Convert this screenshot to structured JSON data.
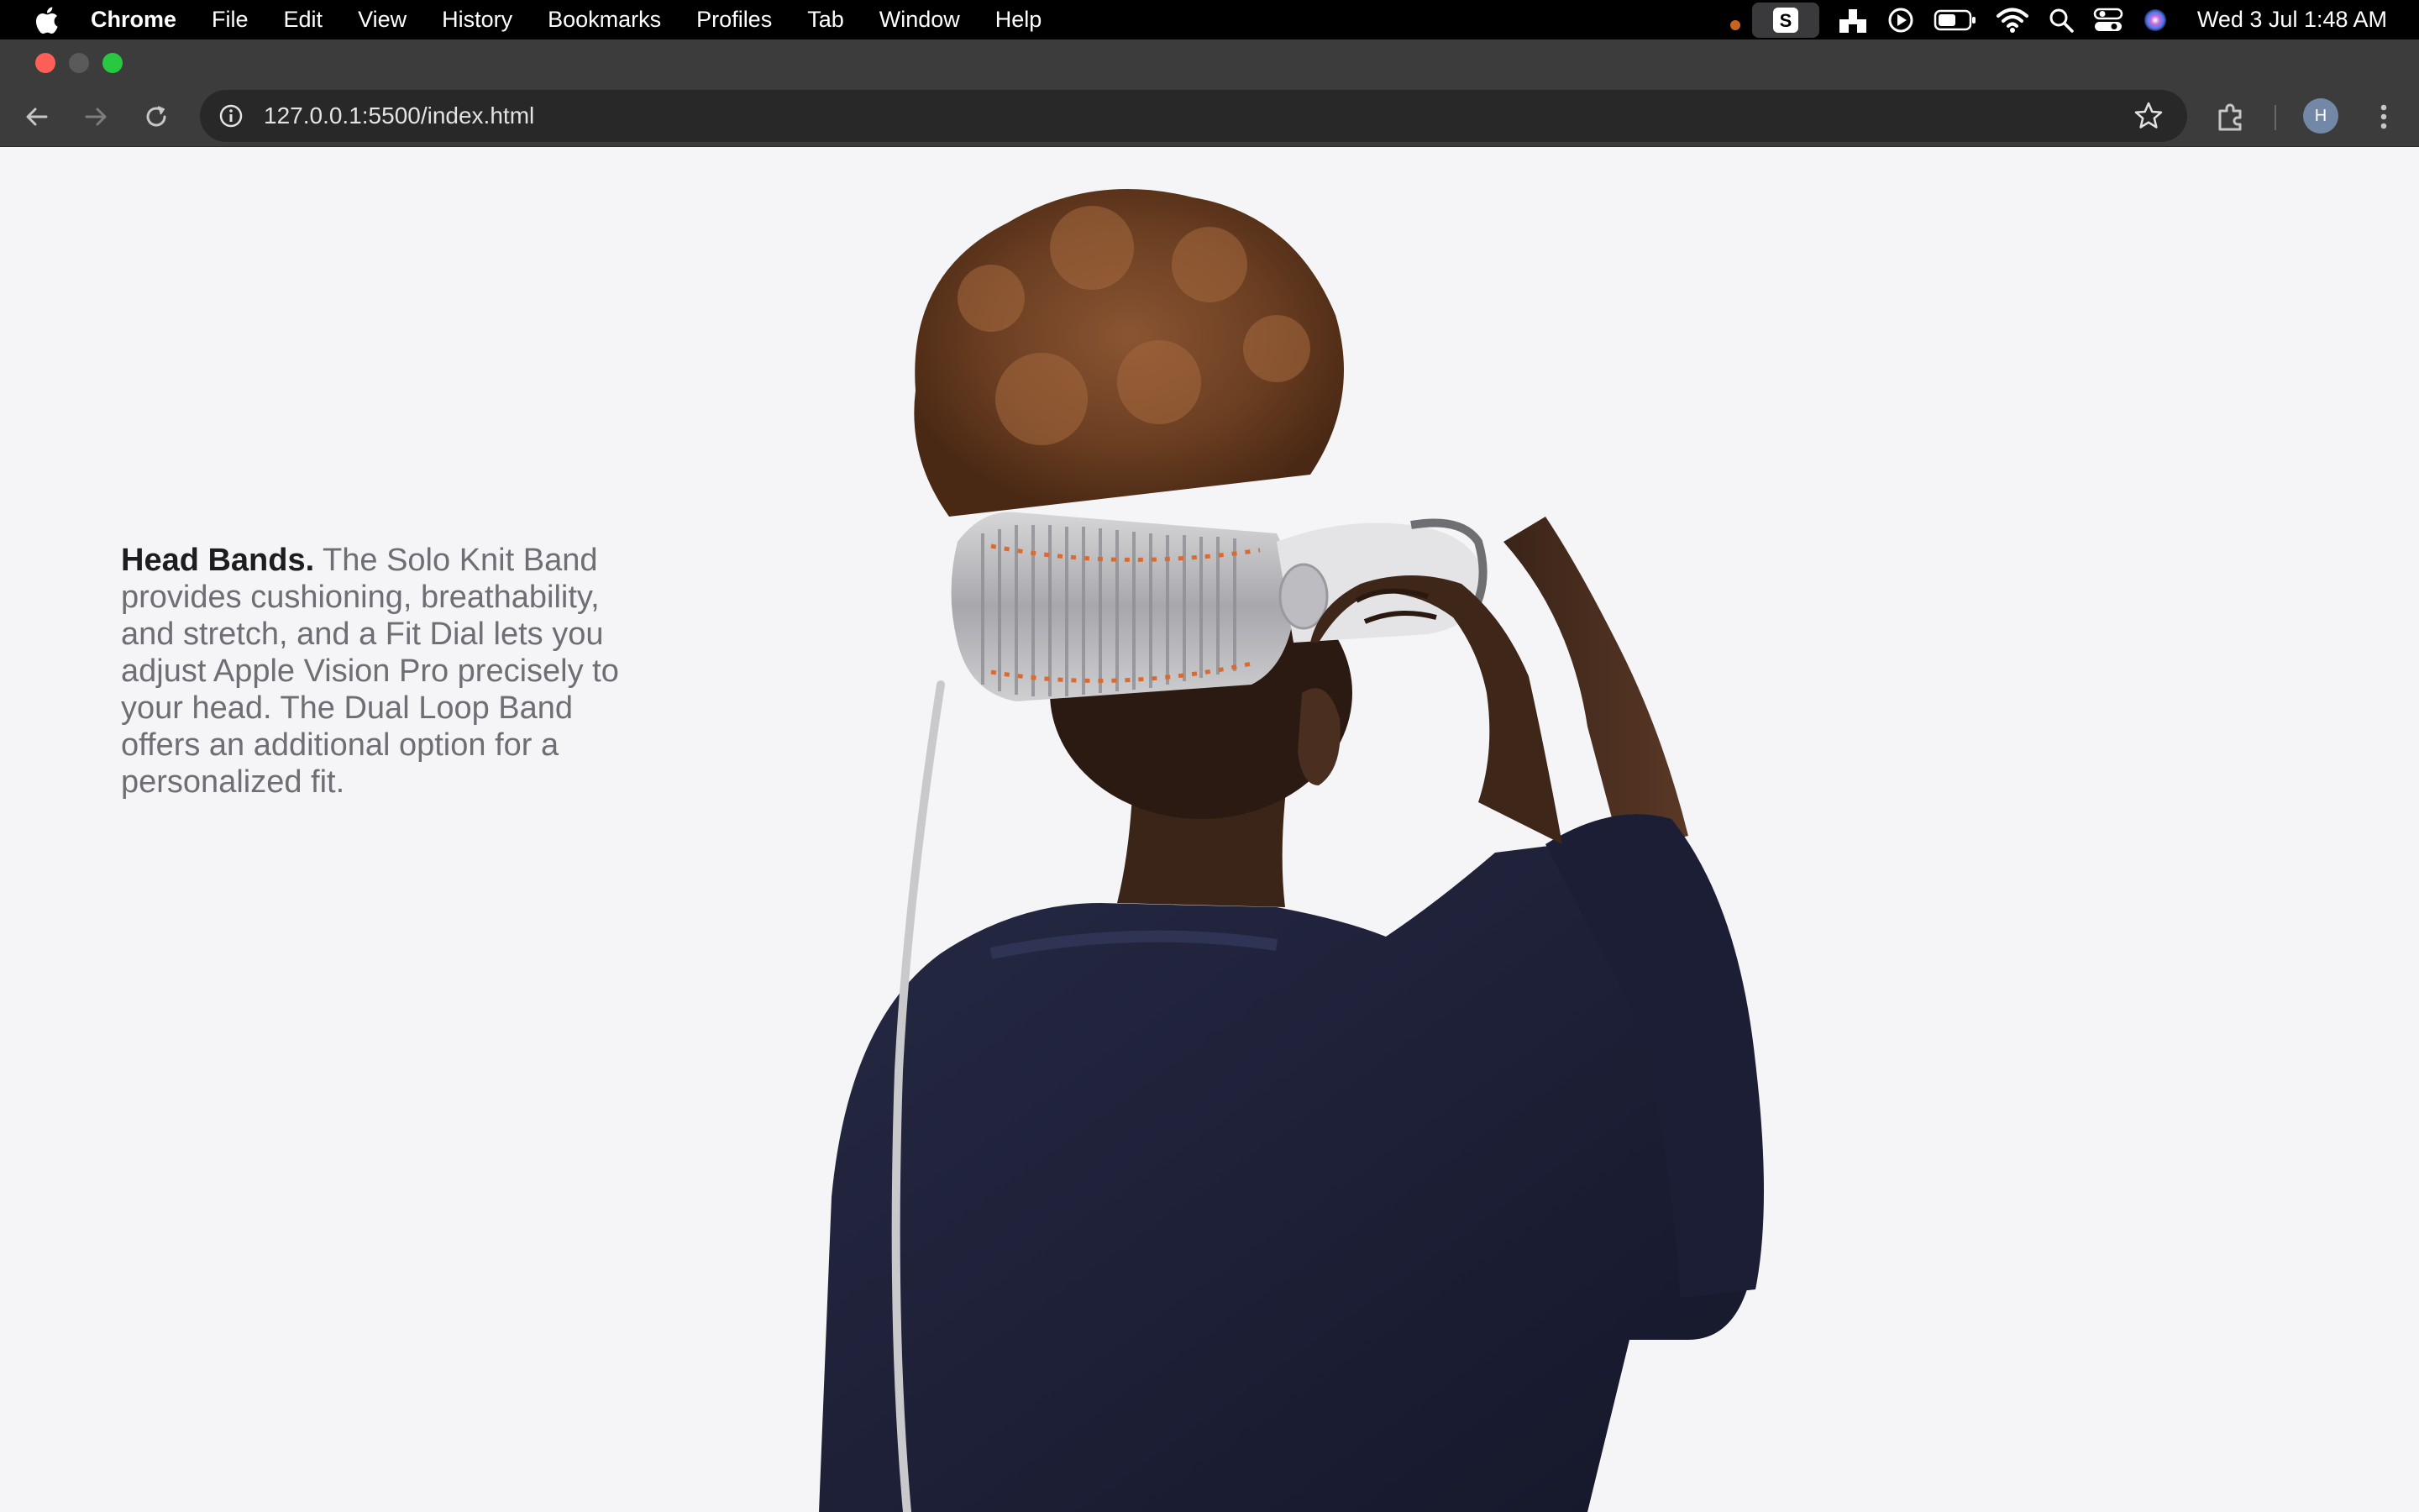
{
  "menubar": {
    "app": "Chrome",
    "items": [
      "File",
      "Edit",
      "View",
      "History",
      "Bookmarks",
      "Profiles",
      "Tab",
      "Window",
      "Help"
    ],
    "clock": "Wed 3 Jul  1:48 AM",
    "status_icons": [
      "apple-logo-icon",
      "record-dot-icon",
      "s-app-icon",
      "dock-icon",
      "play-icon",
      "battery-icon",
      "wifi-icon",
      "spotlight-icon",
      "control-center-icon",
      "siri-icon"
    ]
  },
  "browser": {
    "url": "127.0.0.1:5500/index.html",
    "profile_initial": "H"
  },
  "content": {
    "lead": "Head Bands.",
    "body": " The Solo Knit Band provides cushioning, breathability, and stretch, and a Fit Dial lets you adjust Apple Vision Pro precisely to your head. The Dual Loop Band offers an additional option for a personalized fit."
  },
  "colors": {
    "page_bg": "#f5f5f7",
    "lead_text": "#1d1d1f",
    "body_text": "#6e6e73",
    "sweater": "#1e2034",
    "hair": "#7a4a2a"
  }
}
